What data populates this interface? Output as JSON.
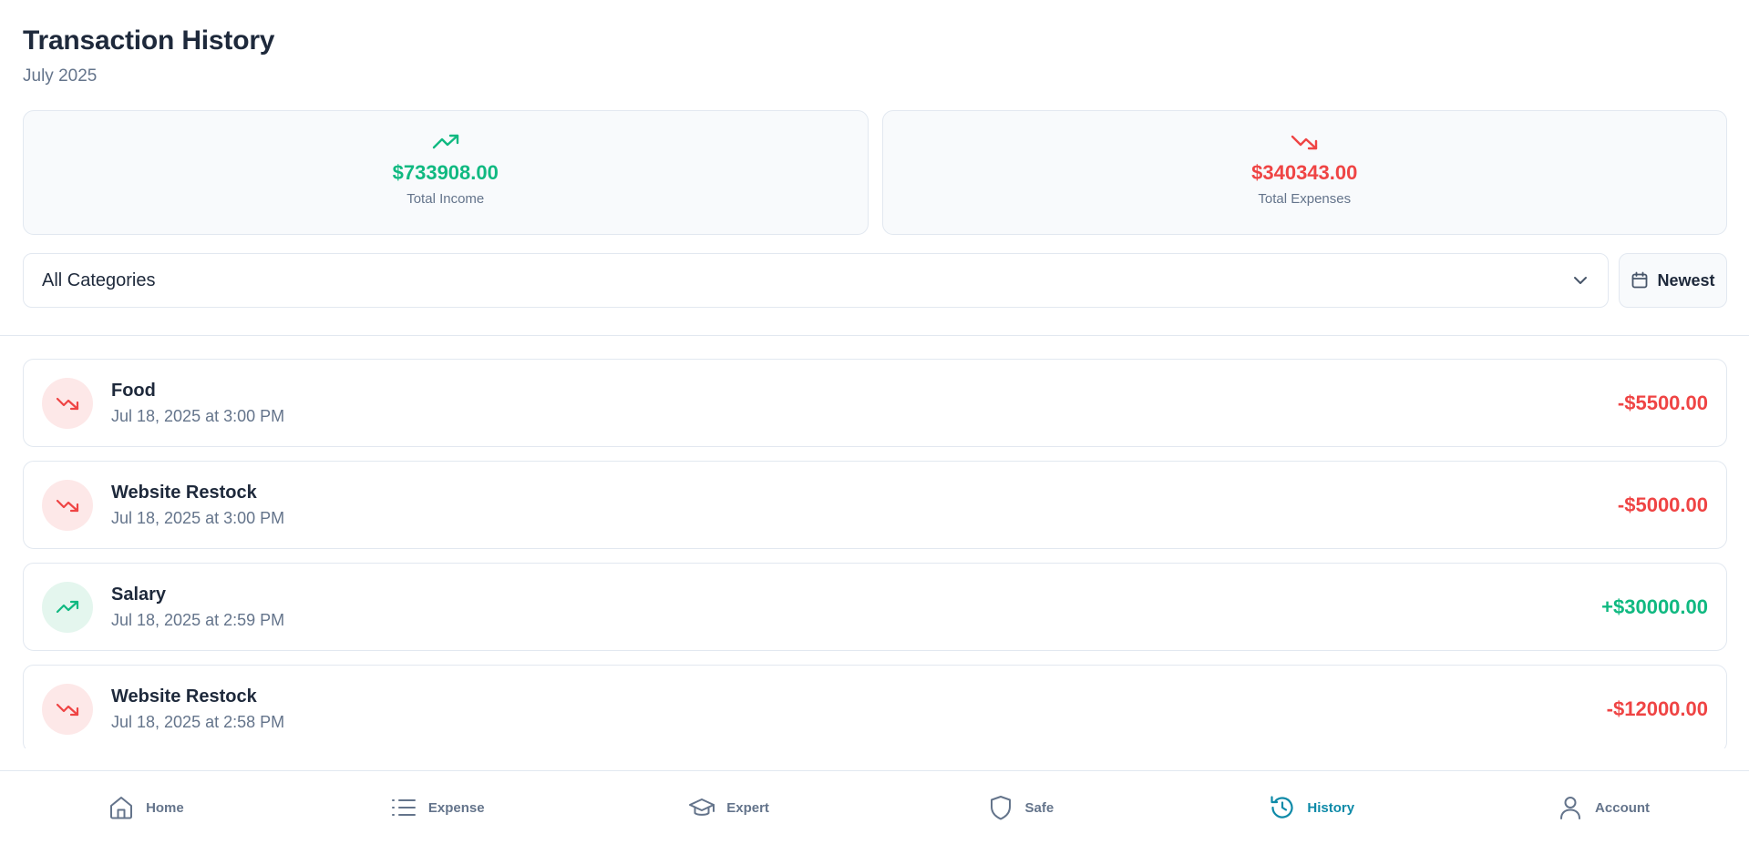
{
  "header": {
    "title": "Transaction History",
    "subtitle": "July 2025"
  },
  "summary": {
    "income": {
      "amount": "$733908.00",
      "label": "Total Income",
      "icon": "trending-up-icon",
      "color": "#10b981"
    },
    "expenses": {
      "amount": "$340343.00",
      "label": "Total Expenses",
      "icon": "trending-down-icon",
      "color": "#ef4444"
    }
  },
  "filters": {
    "category_value": "All Categories",
    "sort_label": "Newest"
  },
  "transactions": [
    {
      "title": "Food",
      "date": "Jul 18, 2025 at 3:00 PM",
      "amount": "-$5500.00",
      "type": "expense"
    },
    {
      "title": "Website Restock",
      "date": "Jul 18, 2025 at 3:00 PM",
      "amount": "-$5000.00",
      "type": "expense"
    },
    {
      "title": "Salary",
      "date": "Jul 18, 2025 at 2:59 PM",
      "amount": "+$30000.00",
      "type": "income"
    },
    {
      "title": "Website Restock",
      "date": "Jul 18, 2025 at 2:58 PM",
      "amount": "-$12000.00",
      "type": "expense"
    }
  ],
  "nav": {
    "items": [
      {
        "label": "Home",
        "icon": "home-icon"
      },
      {
        "label": "Expense",
        "icon": "list-icon"
      },
      {
        "label": "Expert",
        "icon": "graduation-cap-icon"
      },
      {
        "label": "Safe",
        "icon": "shield-icon"
      },
      {
        "label": "History",
        "icon": "history-icon",
        "active": true
      },
      {
        "label": "Account",
        "icon": "user-icon"
      }
    ],
    "active_color": "#0e8aa8"
  }
}
